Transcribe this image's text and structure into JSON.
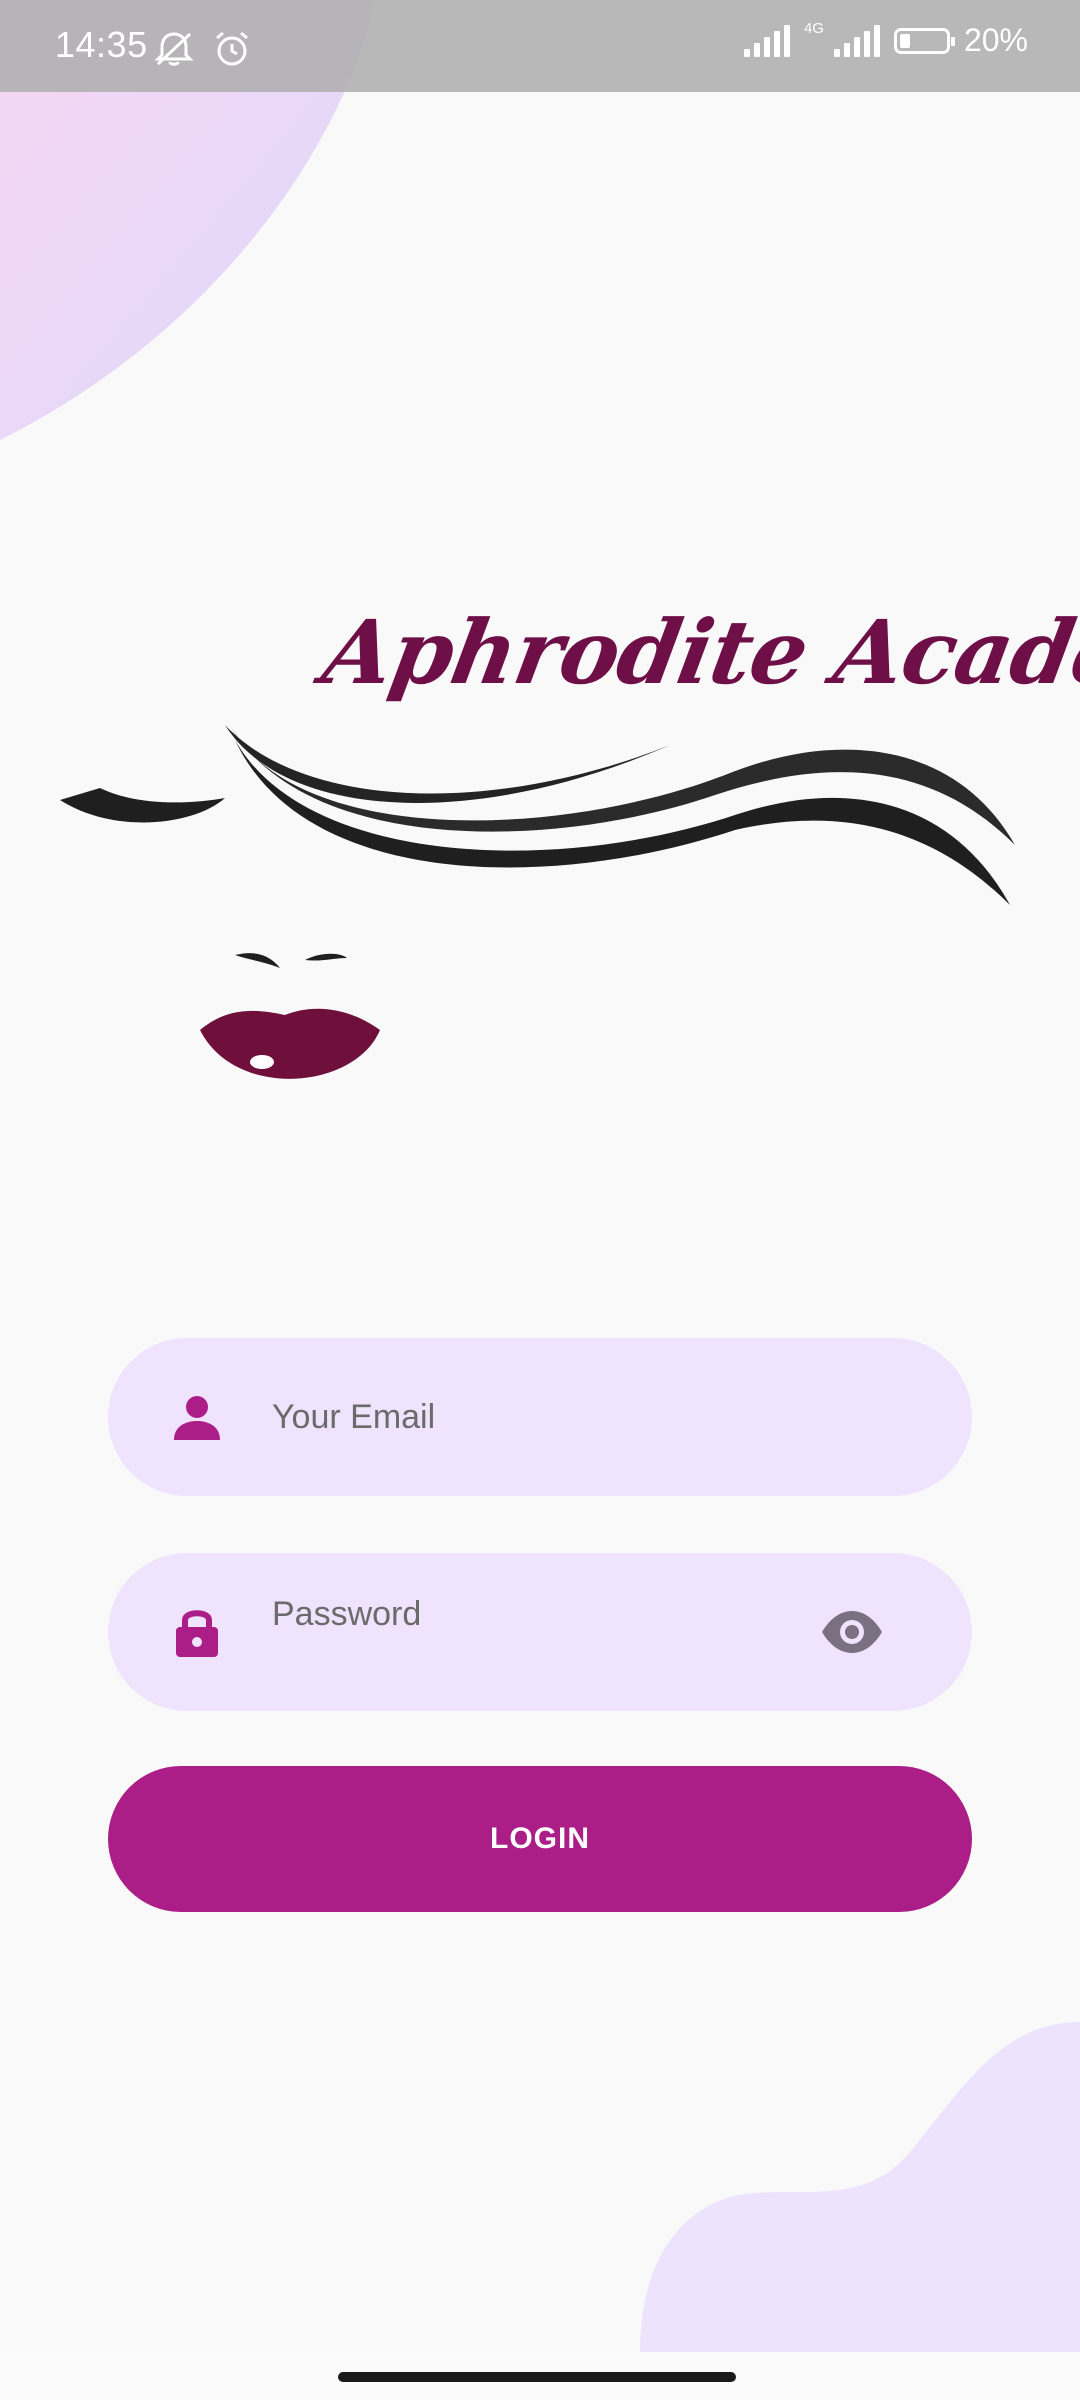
{
  "status_bar": {
    "time": "14:35",
    "battery_percent": "20%",
    "network_type": "4G",
    "icons": [
      "mute-notifications-icon",
      "alarm-icon",
      "signal-icon",
      "signal-4g-icon",
      "battery-icon"
    ]
  },
  "brand": {
    "name": "Aphrodite Academy",
    "colors": {
      "primary": "#ab1e88",
      "logo": "#6e0f48",
      "field_background": "#efe3fd"
    }
  },
  "form": {
    "email": {
      "placeholder": "Your Email",
      "value": "",
      "icon": "person-icon"
    },
    "password": {
      "placeholder": "Password",
      "value": "",
      "icon": "lock-icon",
      "toggle_icon": "eye-icon"
    },
    "login_label": "LOGIN"
  }
}
